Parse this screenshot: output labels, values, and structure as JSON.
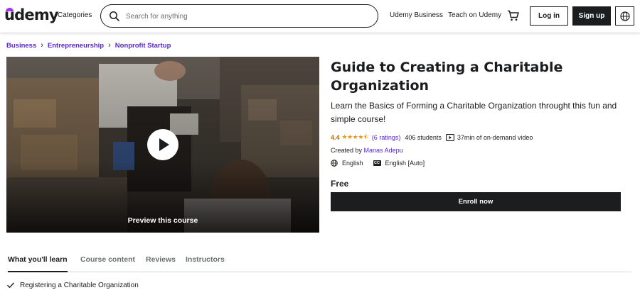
{
  "header": {
    "logo": "udemy",
    "categories": "Categories",
    "search_placeholder": "Search for anything",
    "udemy_business": "Udemy Business",
    "teach": "Teach on Udemy",
    "login": "Log in",
    "signup": "Sign up"
  },
  "breadcrumb": [
    "Business",
    "Entrepreneurship",
    "Nonprofit Startup"
  ],
  "preview": {
    "label": "Preview this course"
  },
  "course": {
    "title": "Guide to Creating a Charitable Organization",
    "subtitle": "Learn the Basics of Forming a Charitable Organization throught this fun and simple course!",
    "rating": "4.4",
    "stars": "★★★★⯪",
    "rating_count": "(6 ratings)",
    "students": "406 students",
    "duration": "37min of on-demand video",
    "created_by_label": "Created by",
    "author": "Manas Adepu",
    "language": "English",
    "captions": "English [Auto]",
    "cc": "CC",
    "price": "Free",
    "enroll": "Enroll now"
  },
  "tabs": [
    {
      "label": "What you'll learn"
    },
    {
      "label": "Course content"
    },
    {
      "label": "Reviews"
    },
    {
      "label": "Instructors"
    }
  ],
  "learn": [
    "Registering a Charitable Organization"
  ],
  "colors": {
    "brand": "#a435f0",
    "link": "#5624d0",
    "dark": "#1c1d1f",
    "star": "#e59819",
    "rating": "#b4690e"
  }
}
